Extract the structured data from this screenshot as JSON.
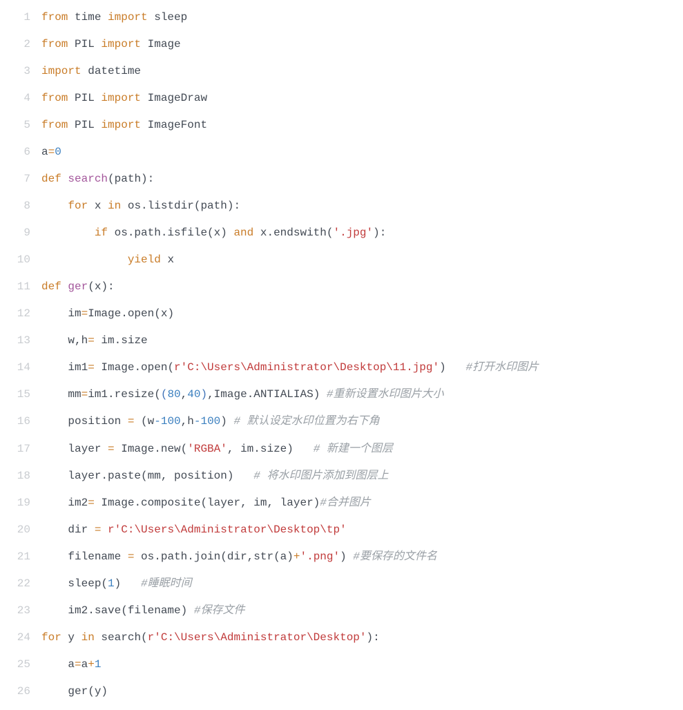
{
  "code": {
    "lines": [
      {
        "num": "1",
        "tokens": [
          {
            "c": "kw",
            "t": "from"
          },
          {
            "c": "id",
            "t": " time "
          },
          {
            "c": "kw",
            "t": "import"
          },
          {
            "c": "id",
            "t": " sleep"
          }
        ]
      },
      {
        "num": "2",
        "tokens": [
          {
            "c": "kw",
            "t": "from"
          },
          {
            "c": "id",
            "t": " PIL "
          },
          {
            "c": "kw",
            "t": "import"
          },
          {
            "c": "id",
            "t": " Image"
          }
        ]
      },
      {
        "num": "3",
        "tokens": [
          {
            "c": "kw",
            "t": "import"
          },
          {
            "c": "id",
            "t": " datetime"
          }
        ]
      },
      {
        "num": "4",
        "tokens": [
          {
            "c": "kw",
            "t": "from"
          },
          {
            "c": "id",
            "t": " PIL "
          },
          {
            "c": "kw",
            "t": "import"
          },
          {
            "c": "id",
            "t": " ImageDraw"
          }
        ]
      },
      {
        "num": "5",
        "tokens": [
          {
            "c": "kw",
            "t": "from"
          },
          {
            "c": "id",
            "t": " PIL "
          },
          {
            "c": "kw",
            "t": "import"
          },
          {
            "c": "id",
            "t": " ImageFont"
          }
        ]
      },
      {
        "num": "6",
        "tokens": [
          {
            "c": "id",
            "t": "a"
          },
          {
            "c": "eq",
            "t": "="
          },
          {
            "c": "num",
            "t": "0"
          }
        ]
      },
      {
        "num": "7",
        "tokens": [
          {
            "c": "kw",
            "t": "def"
          },
          {
            "c": "id",
            "t": " "
          },
          {
            "c": "fn",
            "t": "search"
          },
          {
            "c": "id",
            "t": "(path):"
          }
        ]
      },
      {
        "num": "8",
        "tokens": [
          {
            "c": "id",
            "t": "    "
          },
          {
            "c": "kw",
            "t": "for"
          },
          {
            "c": "id",
            "t": " x "
          },
          {
            "c": "kw",
            "t": "in"
          },
          {
            "c": "id",
            "t": " os.listdir(path):"
          }
        ]
      },
      {
        "num": "9",
        "tokens": [
          {
            "c": "id",
            "t": "        "
          },
          {
            "c": "kw",
            "t": "if"
          },
          {
            "c": "id",
            "t": " os.path.isfile(x) "
          },
          {
            "c": "kw",
            "t": "and"
          },
          {
            "c": "id",
            "t": " x.endswith("
          },
          {
            "c": "str",
            "t": "'.jpg'"
          },
          {
            "c": "id",
            "t": "):"
          }
        ]
      },
      {
        "num": "10",
        "tokens": [
          {
            "c": "id",
            "t": "             "
          },
          {
            "c": "kw",
            "t": "yield"
          },
          {
            "c": "id",
            "t": " x"
          }
        ]
      },
      {
        "num": "11",
        "tokens": [
          {
            "c": "kw",
            "t": "def"
          },
          {
            "c": "id",
            "t": " "
          },
          {
            "c": "fn",
            "t": "ger"
          },
          {
            "c": "id",
            "t": "(x):"
          }
        ]
      },
      {
        "num": "12",
        "tokens": [
          {
            "c": "id",
            "t": "    im"
          },
          {
            "c": "eq",
            "t": "="
          },
          {
            "c": "id",
            "t": "Image.open(x)"
          }
        ]
      },
      {
        "num": "13",
        "tokens": [
          {
            "c": "id",
            "t": "    w,h"
          },
          {
            "c": "eq",
            "t": "="
          },
          {
            "c": "id",
            "t": " im.size"
          }
        ]
      },
      {
        "num": "14",
        "tokens": [
          {
            "c": "id",
            "t": "    im1"
          },
          {
            "c": "eq",
            "t": "="
          },
          {
            "c": "id",
            "t": " Image.open("
          },
          {
            "c": "str",
            "t": "r'C:\\Users\\Administrator\\Desktop\\11.jpg'"
          },
          {
            "c": "id",
            "t": ")   "
          },
          {
            "c": "cmt",
            "t": "#打开水印图片"
          }
        ]
      },
      {
        "num": "15",
        "tokens": [
          {
            "c": "id",
            "t": "    mm"
          },
          {
            "c": "eq",
            "t": "="
          },
          {
            "c": "id",
            "t": "im1.resize("
          },
          {
            "c": "par",
            "t": "("
          },
          {
            "c": "num",
            "t": "80"
          },
          {
            "c": "id",
            "t": ","
          },
          {
            "c": "num",
            "t": "40"
          },
          {
            "c": "par",
            "t": ")"
          },
          {
            "c": "id",
            "t": ",Image.ANTIALIAS) "
          },
          {
            "c": "cmt",
            "t": "#重新设置水印图片大小"
          }
        ]
      },
      {
        "num": "16",
        "tokens": [
          {
            "c": "id",
            "t": "    position "
          },
          {
            "c": "eq",
            "t": "="
          },
          {
            "c": "id",
            "t": " (w"
          },
          {
            "c": "num",
            "t": "-100"
          },
          {
            "c": "id",
            "t": ",h"
          },
          {
            "c": "num",
            "t": "-100"
          },
          {
            "c": "id",
            "t": ") "
          },
          {
            "c": "cmt",
            "t": "# 默认设定水印位置为右下角"
          }
        ]
      },
      {
        "num": "17",
        "tokens": [
          {
            "c": "id",
            "t": "    layer "
          },
          {
            "c": "eq",
            "t": "="
          },
          {
            "c": "id",
            "t": " Image.new("
          },
          {
            "c": "str",
            "t": "'RGBA'"
          },
          {
            "c": "id",
            "t": ", im.size)   "
          },
          {
            "c": "cmt",
            "t": "# 新建一个图层"
          }
        ]
      },
      {
        "num": "18",
        "tokens": [
          {
            "c": "id",
            "t": "    layer.paste(mm, position)   "
          },
          {
            "c": "cmt",
            "t": "# 将水印图片添加到图层上"
          }
        ]
      },
      {
        "num": "19",
        "tokens": [
          {
            "c": "id",
            "t": "    im2"
          },
          {
            "c": "eq",
            "t": "="
          },
          {
            "c": "id",
            "t": " Image.composite(layer, im, layer)"
          },
          {
            "c": "cmt",
            "t": "#合并图片"
          }
        ]
      },
      {
        "num": "20",
        "tokens": [
          {
            "c": "id",
            "t": "    dir "
          },
          {
            "c": "eq",
            "t": "="
          },
          {
            "c": "id",
            "t": " "
          },
          {
            "c": "str",
            "t": "r'C:\\Users\\Administrator\\Desktop\\tp'"
          }
        ]
      },
      {
        "num": "21",
        "tokens": [
          {
            "c": "id",
            "t": "    filename "
          },
          {
            "c": "eq",
            "t": "="
          },
          {
            "c": "id",
            "t": " os.path.join(dir,str(a)"
          },
          {
            "c": "eq",
            "t": "+"
          },
          {
            "c": "str",
            "t": "'.png'"
          },
          {
            "c": "id",
            "t": ") "
          },
          {
            "c": "cmt",
            "t": "#要保存的文件名"
          }
        ]
      },
      {
        "num": "22",
        "tokens": [
          {
            "c": "id",
            "t": "    sleep("
          },
          {
            "c": "num",
            "t": "1"
          },
          {
            "c": "id",
            "t": ")   "
          },
          {
            "c": "cmt",
            "t": "#睡眠时间"
          }
        ]
      },
      {
        "num": "23",
        "tokens": [
          {
            "c": "id",
            "t": "    im2.save(filename) "
          },
          {
            "c": "cmt",
            "t": "#保存文件"
          }
        ]
      },
      {
        "num": "24",
        "tokens": [
          {
            "c": "kw",
            "t": "for"
          },
          {
            "c": "id",
            "t": " y "
          },
          {
            "c": "kw",
            "t": "in"
          },
          {
            "c": "id",
            "t": " search("
          },
          {
            "c": "str",
            "t": "r'C:\\Users\\Administrator\\Desktop'"
          },
          {
            "c": "id",
            "t": "):"
          }
        ]
      },
      {
        "num": "25",
        "tokens": [
          {
            "c": "id",
            "t": "    a"
          },
          {
            "c": "eq",
            "t": "="
          },
          {
            "c": "id",
            "t": "a"
          },
          {
            "c": "eq",
            "t": "+"
          },
          {
            "c": "num",
            "t": "1"
          }
        ]
      },
      {
        "num": "26",
        "tokens": [
          {
            "c": "id",
            "t": "    ger(y)"
          }
        ]
      }
    ]
  }
}
